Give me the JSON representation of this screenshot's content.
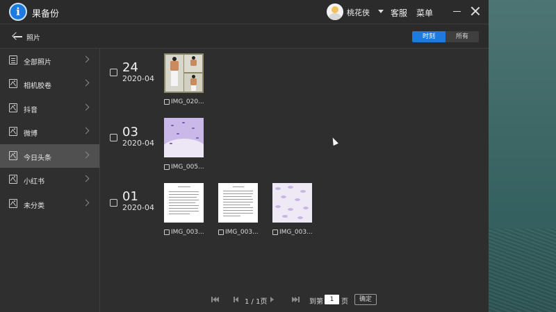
{
  "app": {
    "title": "果备份",
    "logo_letter": "i"
  },
  "header": {
    "username": "桃花侠",
    "service_label": "客服",
    "menu_label": "菜单"
  },
  "nav": {
    "title": "照片",
    "toggle": {
      "options": [
        "时刻",
        "所有"
      ],
      "active": "时刻"
    }
  },
  "sidebar": {
    "items": [
      {
        "label": "全部照片",
        "icon": "document-icon",
        "active": false
      },
      {
        "label": "相机胶卷",
        "icon": "image-icon",
        "active": false
      },
      {
        "label": "抖音",
        "icon": "image-icon",
        "active": false
      },
      {
        "label": "微博",
        "icon": "image-icon",
        "active": false
      },
      {
        "label": "今日头条",
        "icon": "image-icon",
        "active": true
      },
      {
        "label": "小红书",
        "icon": "image-icon",
        "active": false
      },
      {
        "label": "未分类",
        "icon": "image-icon",
        "active": false
      }
    ]
  },
  "groups": [
    {
      "day": "24",
      "month": "2020-04",
      "photos": [
        {
          "name": "IMG_020..."
        }
      ]
    },
    {
      "day": "03",
      "month": "2020-04",
      "photos": [
        {
          "name": "IMG_005..."
        }
      ]
    },
    {
      "day": "01",
      "month": "2020-04",
      "photos": [
        {
          "name": "IMG_003..."
        },
        {
          "name": "IMG_003..."
        },
        {
          "name": "IMG_003..."
        }
      ]
    }
  ],
  "pagination": {
    "page_indicator": "1 / 1页",
    "goto_prefix": "到第",
    "goto_value": "1",
    "goto_suffix": "页",
    "confirm_label": "确定"
  },
  "colors": {
    "accent": "#1f7ae0",
    "window_bg": "#2e2e2e",
    "active_item_bg": "#505050"
  }
}
